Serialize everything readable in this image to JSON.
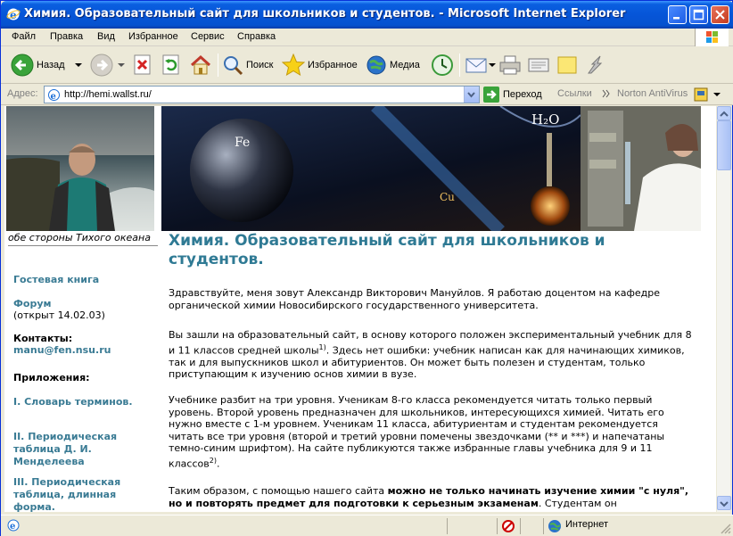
{
  "window": {
    "title": "Химия. Образовательный сайт для школьников и студентов. - Microsoft Internet Explorer"
  },
  "menu": [
    "Файл",
    "Правка",
    "Вид",
    "Избранное",
    "Сервис",
    "Справка"
  ],
  "toolbar": {
    "back_label": "Назад",
    "search_label": "Поиск",
    "favorites_label": "Избранное",
    "media_label": "Медиа"
  },
  "address": {
    "label": "Адрес:",
    "url": "http://hemi.wallst.ru/",
    "go_label": "Переход",
    "links_label": "Ссылки",
    "norton_label": "Norton AntiVirus"
  },
  "sidebar": {
    "photo_caption": "обе стороны Тихого океана",
    "guestbook": "Гостевая книга",
    "forum": "Форум",
    "forum_note": "(открыт 14.02.03)",
    "contacts_head": "Контакты:",
    "email": "manu@fen.nsu.ru",
    "apps_head": "Приложения:",
    "app1": "I. Словарь терминов.",
    "app2": "II. Периодическая таблица Д. И. Менделеева",
    "app3": "III. Периодическая таблица, длинная форма."
  },
  "banner": {
    "fe": "Fe",
    "cu": "Cu",
    "h2o": "H₂O"
  },
  "main": {
    "title": "Химия. Образовательный сайт для школьников и студентов.",
    "p1": "Здравствуйте, меня зовут Александр Викторович Мануйлов. Я работаю доцентом на кафедре органической химии Новосибирского государственного университета.",
    "p2a": "Вы зашли на образовательный сайт, в основу которого положен экспериментальный учебник для 8 и 11 классов средней школы",
    "p2sup": "1)",
    "p2b": ". Здесь нет ошибки: учебник написан как для начинающих химиков, так и для выпускников школ и абитуриентов. Он может быть полезен и студентам, только приступающим к изучению основ химии в вузе.",
    "p3a": "Учебнике разбит на три уровня. Ученикам 8-го класса рекомендуется читать только первый уровень. Второй уровень предназначен для школьников, интересующихся химией. Читать его нужно вместе с 1-м уровнем. Ученикам 11 класса, абитуриентам и студентам рекомендуется читать все три уровня (второй и третий уровни помечены звездочками (** и ***) и напечатаны темно-синим шрифтом). На сайте публикуются также избранные главы учебника для 9 и 11 классов",
    "p3sup": "2)",
    "p3b": ".",
    "p4a": "Таким образом, с помощью нашего сайта ",
    "p4bold": "можно не только начинать изучение химии \"с нуля\", но и повторять предмет для подготовки к серьезным экзаменам",
    "p4b": ". Студентам он"
  },
  "status": {
    "zone": "Интернет"
  }
}
